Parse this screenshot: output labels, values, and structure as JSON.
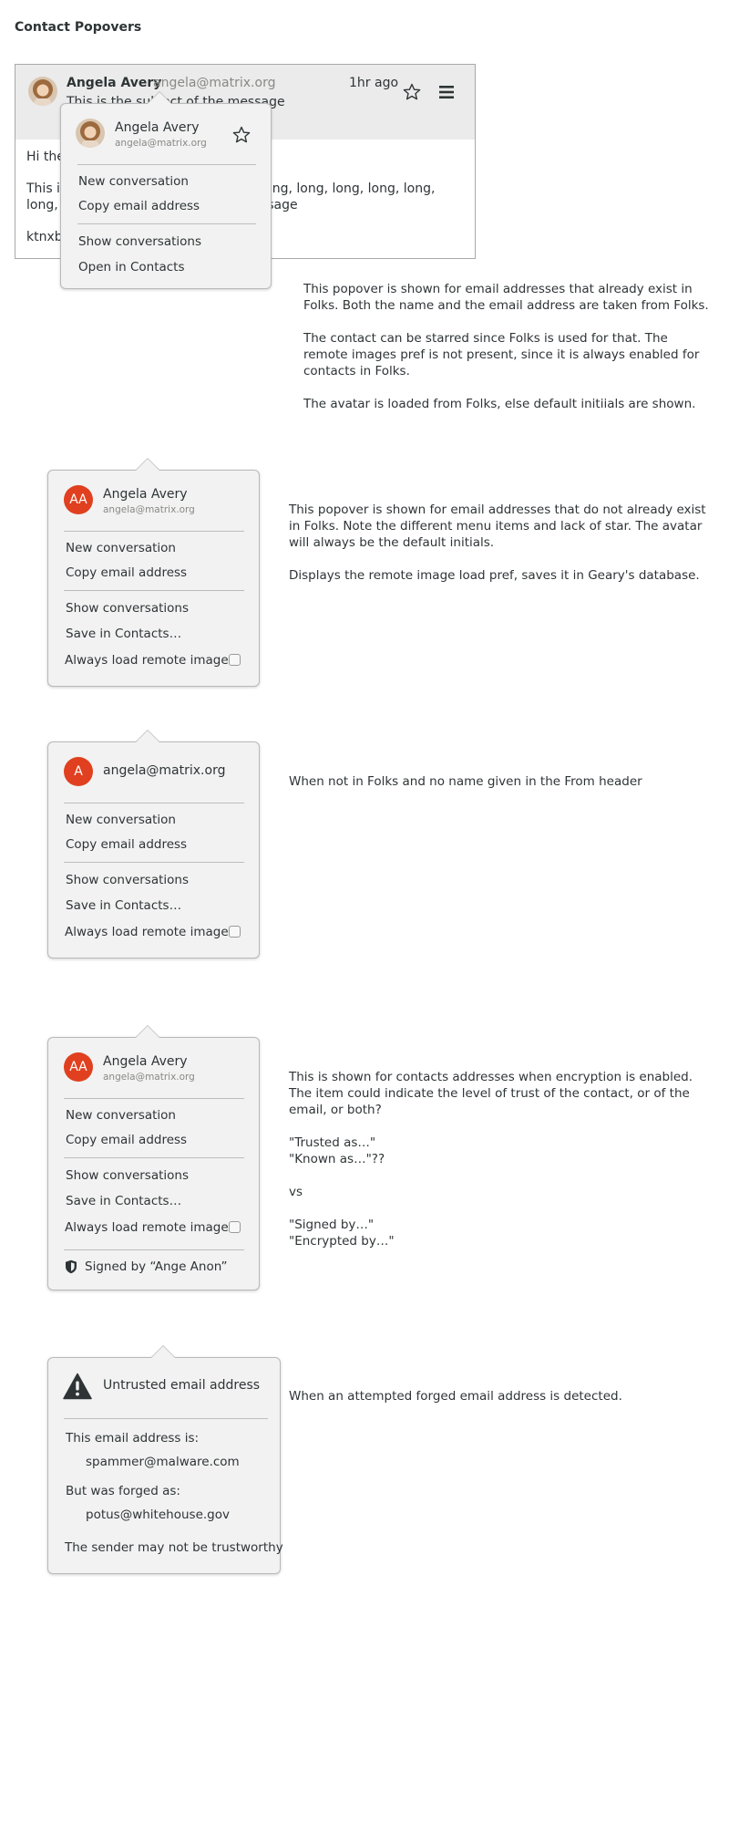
{
  "page_title": "Contact Popovers",
  "message": {
    "from_name": "Angela Avery",
    "from_email": "angela@matrix.org",
    "time": "1hr ago",
    "subject": "This is the subject of the message",
    "body": [
      "Hi there,",
      "This is a long, long, long, long, long, long, long, long, long, long, long, long, long, long, long, long, message",
      "ktnxbye"
    ]
  },
  "icons": {
    "star": "star-icon",
    "menu": "hamburger-menu-icon",
    "shield": "shield-icon",
    "warning": "warning-icon"
  },
  "colors": {
    "avatar_initials_bg": "#e0401f",
    "header_bg": "#ebebeb",
    "popover_bg": "#f2f2f2"
  },
  "popovers": [
    {
      "name": "Angela Avery",
      "email": "angela@matrix.org",
      "items": [
        "New conversation",
        "Copy email address",
        "Show conversations",
        "Open in Contacts"
      ],
      "description": [
        "This popover is shown for email addresses that already exist in Folks. Both the name and the email address are taken from Folks.",
        "The contact can be starred since Folks is used for that. The remote images pref is not present, since it is always enabled for contacts in Folks.",
        "The avatar is loaded from Folks, else default initiials are shown."
      ]
    },
    {
      "initials": "AA",
      "name": "Angela Avery",
      "email": "angela@matrix.org",
      "items": [
        "New conversation",
        "Copy email address",
        "Show conversations",
        "Save in Contacts…",
        "Always load remote images"
      ],
      "description": [
        "This popover is shown for email addresses that do not already exist in Folks. Note the different menu items and lack of star. The avatar will always be the default initials.",
        "Displays the remote image load pref, saves it in Geary's database."
      ]
    },
    {
      "initials": "A",
      "email": "angela@matrix.org",
      "items": [
        "New conversation",
        "Copy email address",
        "Show conversations",
        "Save in Contacts…",
        "Always load remote images"
      ],
      "description": [
        "When not in Folks and no name given in the From header"
      ]
    },
    {
      "initials": "AA",
      "name": "Angela Avery",
      "email": "angela@matrix.org",
      "items": [
        "New conversation",
        "Copy email address",
        "Show conversations",
        "Save in Contacts…",
        "Always load remote images"
      ],
      "signed": "Signed by “Ange Anon”",
      "description": [
        "This is shown for contacts addresses when encryption is enabled. The item could indicate the level of trust of the contact, or of the email, or both?",
        "\"Trusted as…\"",
        "\"Known as…\"??",
        "vs",
        "\"Signed by…\"",
        "\"Encrypted by…\""
      ]
    },
    {
      "title": "Untrusted email address",
      "label_is": "This email address is:",
      "actual": "spammer@malware.com",
      "label_forged": "But was forged as:",
      "forged": "potus@whitehouse.gov",
      "note": "The sender may not be trustworthy",
      "description": [
        "When an attempted forged email address is detected."
      ]
    }
  ]
}
